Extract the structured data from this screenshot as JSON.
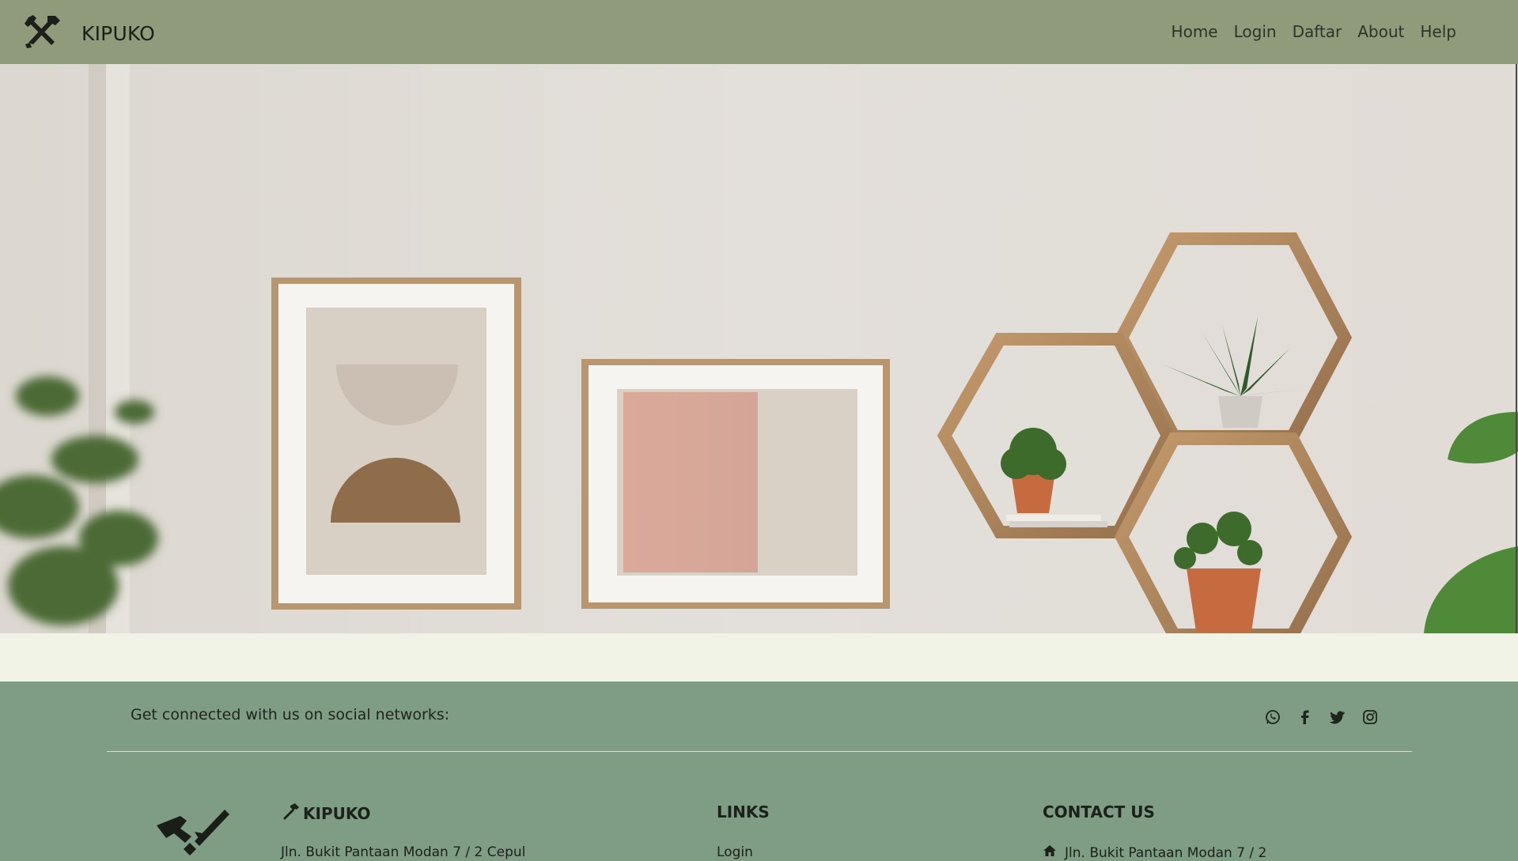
{
  "brand": {
    "name": "KIPUKO",
    "logo_icon": "hammer-wrench-icon"
  },
  "nav": {
    "items": [
      "Home",
      "Login",
      "Daftar",
      "About",
      "Help"
    ]
  },
  "hero": {
    "image": "interior-wall-with-frames-and-hexagon-shelves"
  },
  "footer": {
    "social_text": "Get connected with us on social networks:",
    "social_icons": [
      "whatsapp-icon",
      "facebook-icon",
      "twitter-icon",
      "instagram-icon"
    ],
    "brand_title": "KIPUKO",
    "brand_address": "Jln. Bukit Pantaan Modan 7 / 2 Cepul",
    "links_title": "LINKS",
    "links_first": "Login",
    "contact_title": "CONTACT US",
    "contact_address": "Jln. Bukit Pantaan Modan 7 / 2"
  },
  "colors": {
    "navbar": "#909b7b",
    "footer": "#7f9c85",
    "band": "#f2f3e7"
  }
}
